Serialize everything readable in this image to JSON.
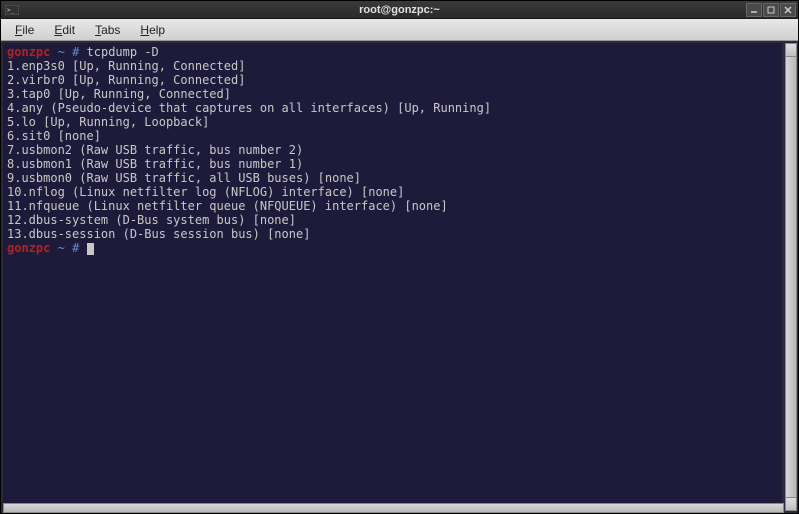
{
  "window": {
    "title": "root@gonzpc:~"
  },
  "menu": {
    "file": "File",
    "edit": "Edit",
    "tabs": "Tabs",
    "help": "Help"
  },
  "prompt": {
    "host": "gonzpc",
    "path": "~",
    "symbol": "#"
  },
  "command": "tcpdump -D",
  "output": [
    "1.enp3s0 [Up, Running, Connected]",
    "2.virbr0 [Up, Running, Connected]",
    "3.tap0 [Up, Running, Connected]",
    "4.any (Pseudo-device that captures on all interfaces) [Up, Running]",
    "5.lo [Up, Running, Loopback]",
    "6.sit0 [none]",
    "7.usbmon2 (Raw USB traffic, bus number 2)",
    "8.usbmon1 (Raw USB traffic, bus number 1)",
    "9.usbmon0 (Raw USB traffic, all USB buses) [none]",
    "10.nflog (Linux netfilter log (NFLOG) interface) [none]",
    "11.nfqueue (Linux netfilter queue (NFQUEUE) interface) [none]",
    "12.dbus-system (D-Bus system bus) [none]",
    "13.dbus-session (D-Bus session bus) [none]"
  ]
}
